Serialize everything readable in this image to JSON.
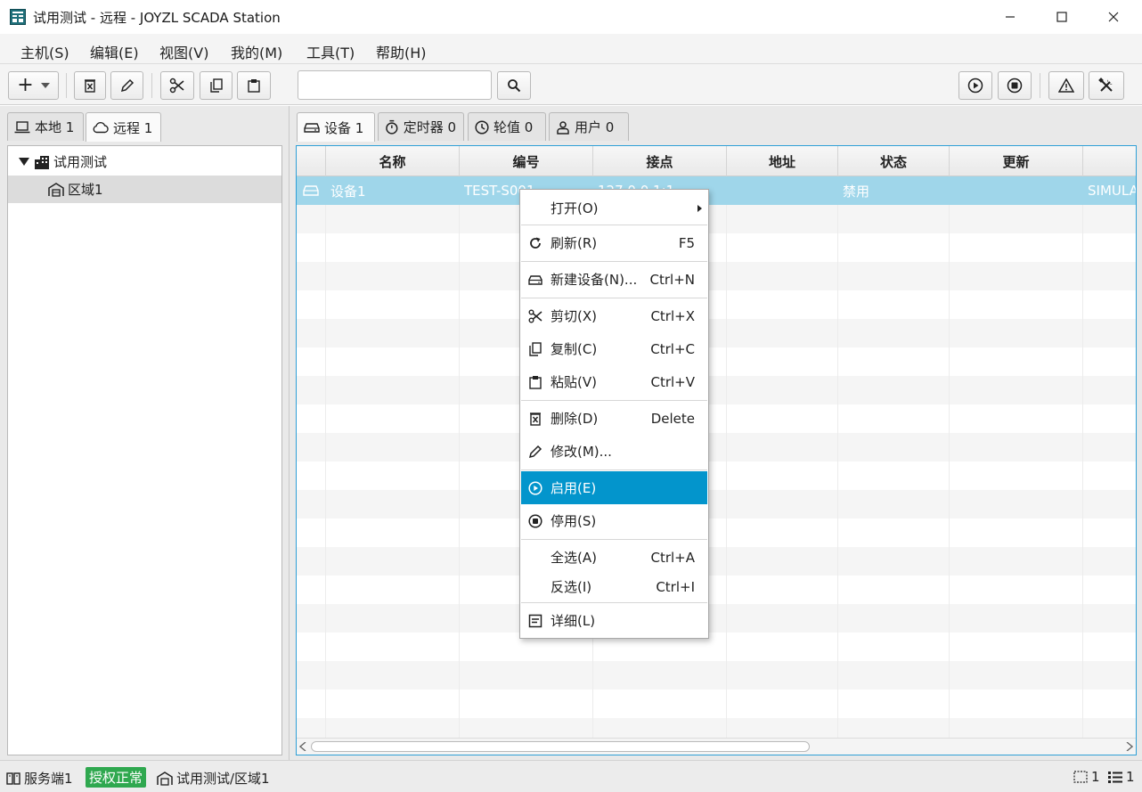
{
  "window": {
    "title": "试用测试 - 远程 - JOYZL SCADA Station"
  },
  "menubar": [
    "主机(S)",
    "编辑(E)",
    "视图(V)",
    "我的(M)",
    "工具(T)",
    "帮助(H)"
  ],
  "toolbar": {
    "add_label": "+",
    "search_placeholder": "",
    "search_value": ""
  },
  "left_tabs": [
    {
      "label": "本地 1",
      "icon": "laptop-icon"
    },
    {
      "label": "远程 1",
      "icon": "cloud-icon"
    }
  ],
  "tree": {
    "root": "试用测试",
    "child": "区域1"
  },
  "right_tabs": [
    {
      "label": "设备 1",
      "icon": "device-icon"
    },
    {
      "label": "定时器 0",
      "icon": "stopwatch-icon"
    },
    {
      "label": "轮值 0",
      "icon": "clock-icon"
    },
    {
      "label": "用户 0",
      "icon": "user-icon"
    }
  ],
  "table": {
    "columns": [
      "名称",
      "编号",
      "接点",
      "地址",
      "状态",
      "更新"
    ],
    "rows": [
      {
        "name": "设备1",
        "code": "TEST-S001",
        "endpoint": "127.0.0.1:1",
        "address": "",
        "status": "禁用",
        "update": "",
        "extra": "SIMULA"
      }
    ]
  },
  "context_menu": {
    "items": [
      {
        "label": "打开(O)",
        "shortcut": "",
        "icon": "",
        "submenu": true
      },
      {
        "label": "刷新(R)",
        "shortcut": "F5",
        "icon": "refresh-icon"
      },
      {
        "label": "新建设备(N)...",
        "shortcut": "Ctrl+N",
        "icon": "device-icon"
      },
      {
        "label": "剪切(X)",
        "shortcut": "Ctrl+X",
        "icon": "scissors-icon"
      },
      {
        "label": "复制(C)",
        "shortcut": "Ctrl+C",
        "icon": "copy-icon"
      },
      {
        "label": "粘贴(V)",
        "shortcut": "Ctrl+V",
        "icon": "paste-icon"
      },
      {
        "label": "删除(D)",
        "shortcut": "Delete",
        "icon": "delete-icon"
      },
      {
        "label": "修改(M)...",
        "shortcut": "",
        "icon": "pencil-icon"
      },
      {
        "label": "启用(E)",
        "shortcut": "",
        "icon": "play-circle-icon",
        "selected": true
      },
      {
        "label": "停用(S)",
        "shortcut": "",
        "icon": "stop-circle-icon"
      },
      {
        "label": "全选(A)",
        "shortcut": "Ctrl+A",
        "icon": ""
      },
      {
        "label": "反选(I)",
        "shortcut": "Ctrl+I",
        "icon": ""
      },
      {
        "label": "详细(L)",
        "shortcut": "",
        "icon": "details-icon"
      }
    ]
  },
  "statusbar": {
    "server": "服务端1",
    "license": "授权正常",
    "path": "试用测试/区域1",
    "selection_count": "1",
    "list_count": "1"
  },
  "colors": {
    "accent": "#0395cc",
    "row_selected": "#9fd6ea",
    "license_green": "#2fa84f",
    "focus_border": "#2e9fd6"
  }
}
